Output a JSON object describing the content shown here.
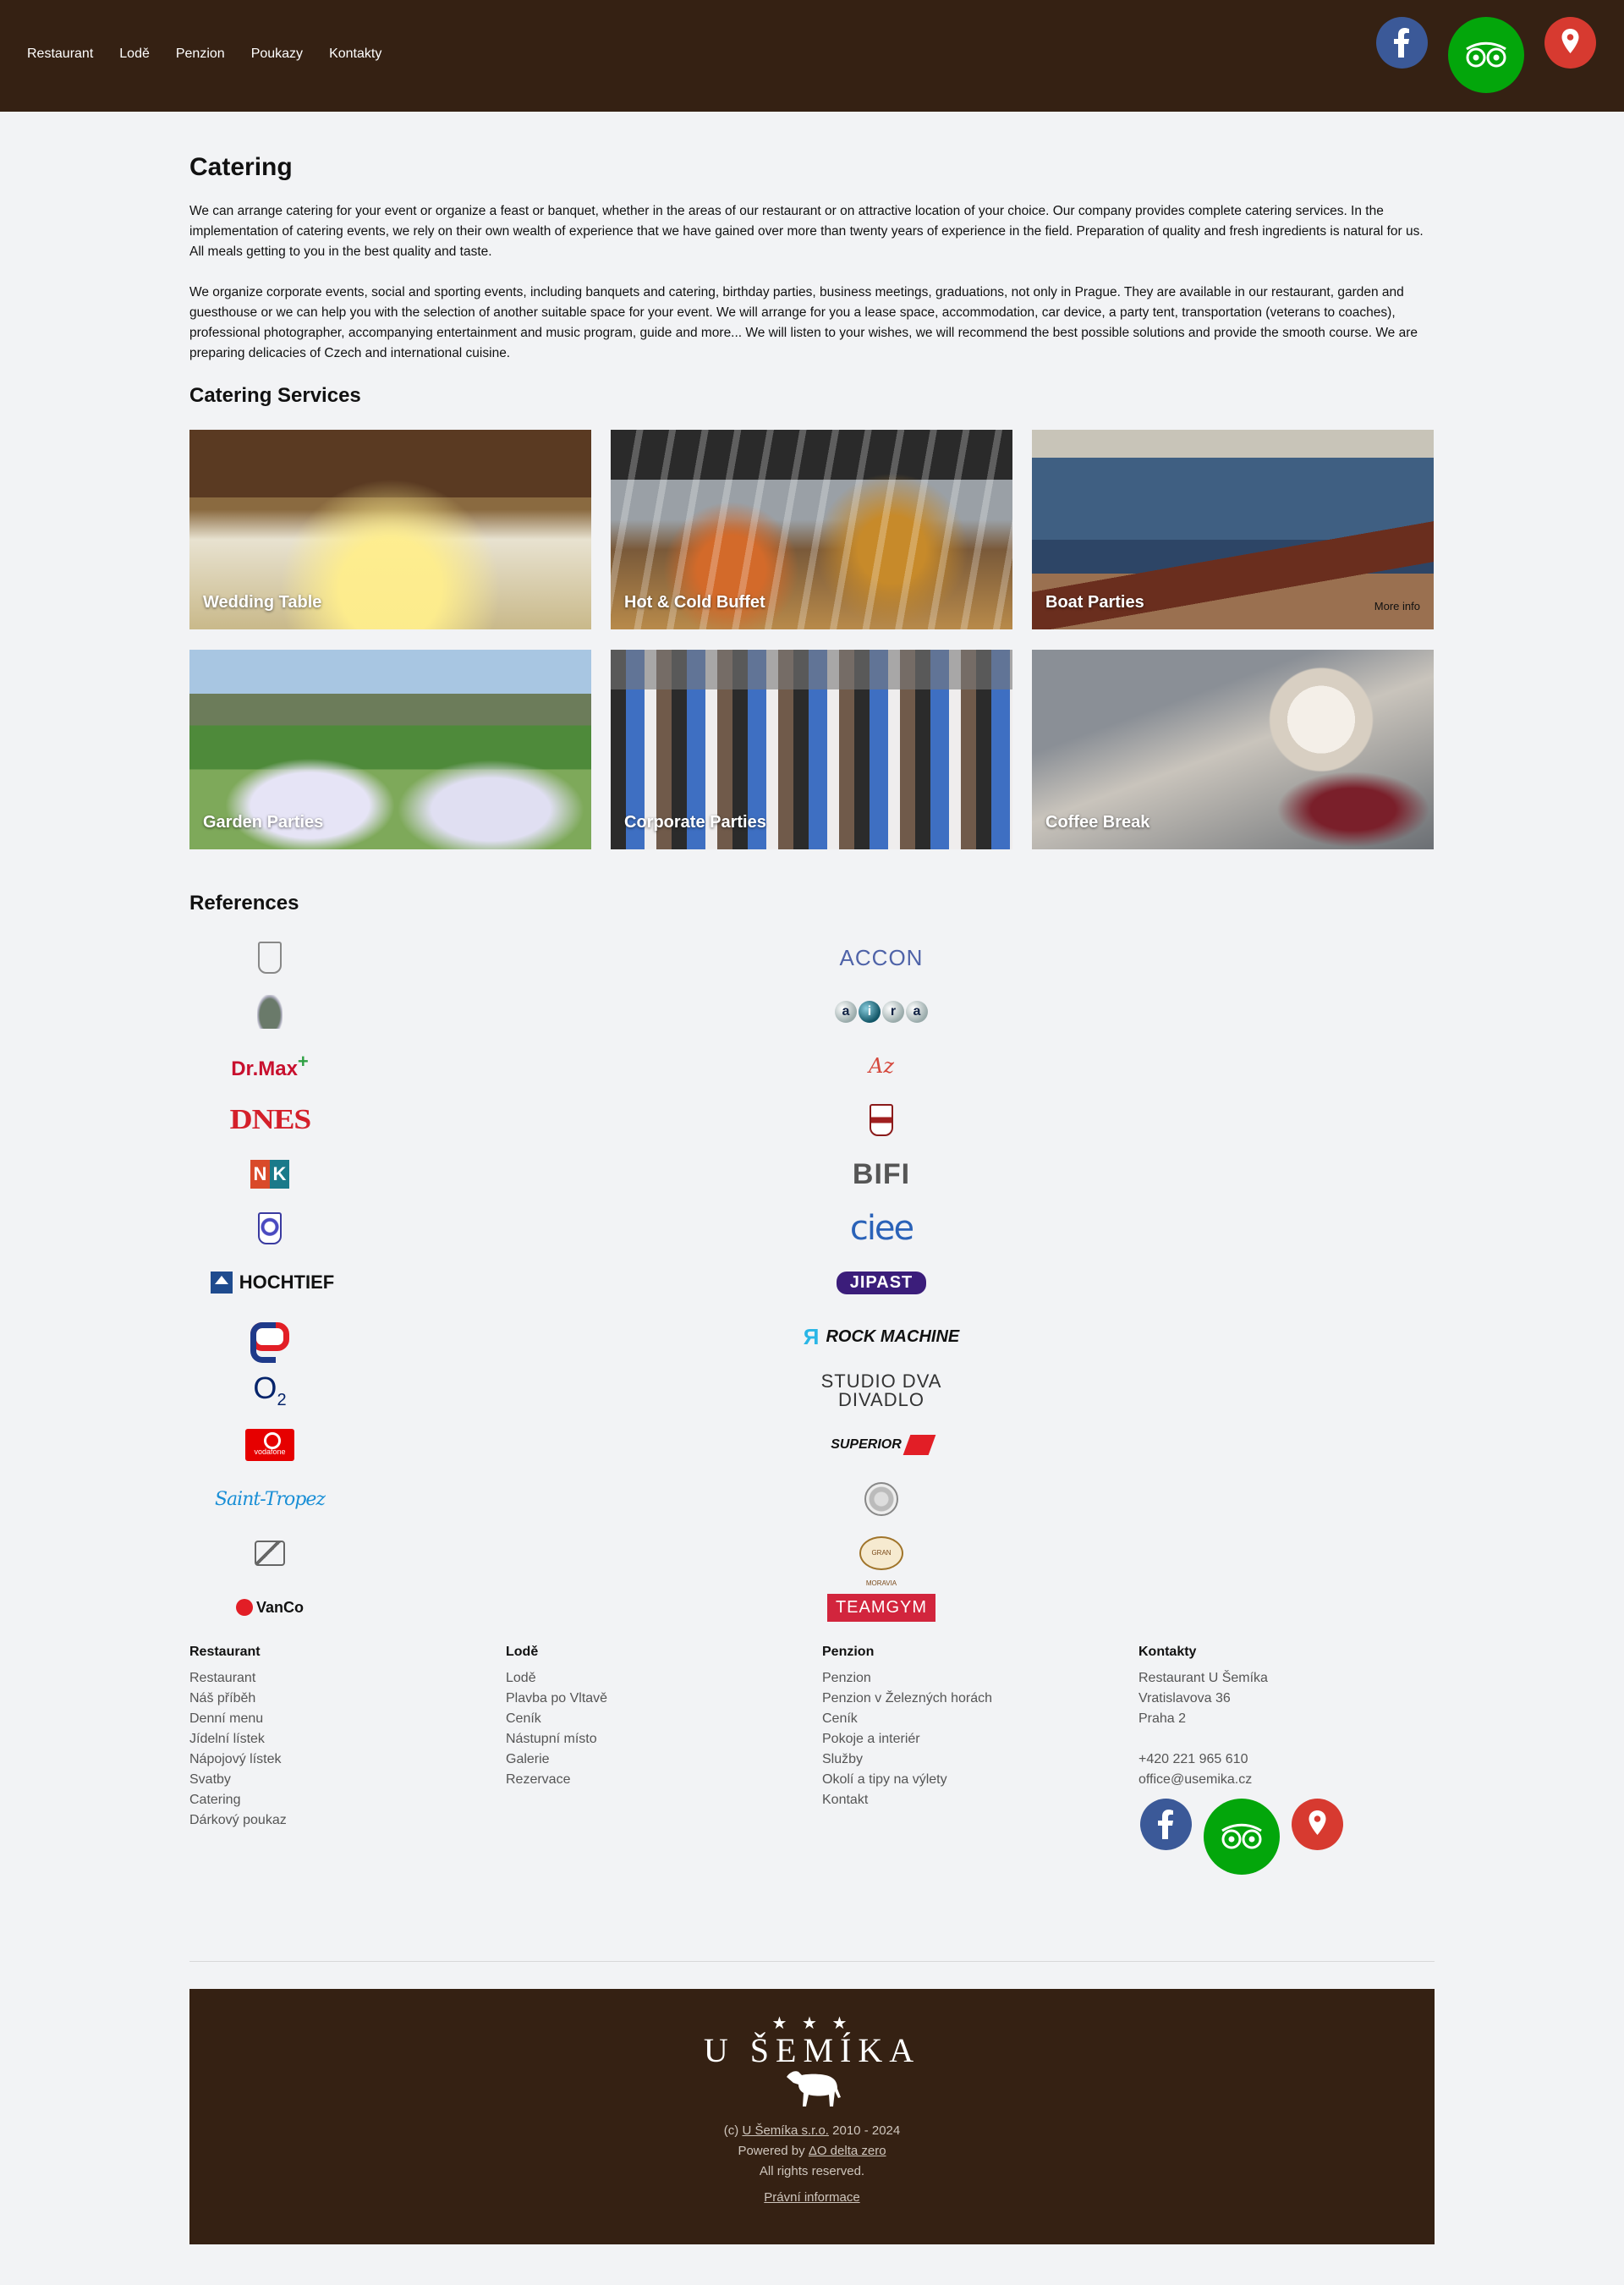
{
  "nav": [
    "Restaurant",
    "Lodě",
    "Penzion",
    "Poukazy",
    "Kontakty"
  ],
  "social": [
    "facebook-icon",
    "tripadvisor-icon",
    "map-pin-icon"
  ],
  "page": {
    "title": "Catering",
    "paragraphs": [
      "We can arrange catering for your event or organize a feast or banquet, whether in the areas of our restaurant or on attractive location of your choice. Our company provides complete catering services. In the implementation of catering events, we rely on their own wealth of experience that we have gained over more than twenty years of experience in the field. Preparation of quality and fresh ingredients is natural for us. All meals getting to you in the best quality and taste.",
      "We organize corporate events, social and sporting events, including banquets and catering, birthday parties, business meetings, graduations, not only in Prague. They are available in our restaurant, garden and guesthouse or we can help you with the selection of another suitable space for your event. We will arrange for you a lease space, accommodation, car device, a party tent, transportation (veterans to coaches), professional photographer, accompanying entertainment and music program, guide and more... We will listen to your wishes, we will recommend the best possible solutions and provide the smooth course. We are preparing delicacies of Czech and international cuisine."
    ]
  },
  "services": {
    "title": "Catering Services",
    "more_label": "More info",
    "items": [
      "Wedding Table",
      "Hot & Cold Buffet",
      "Boat Parties",
      "Garden Parties",
      "Corporate Parties",
      "Coffee Break"
    ]
  },
  "references": {
    "title": "References",
    "left": [
      "",
      "",
      "Dr.Max",
      "DNES",
      "NK",
      "",
      "HOCHTIEF",
      "",
      "O2",
      "vodafone",
      "Saint-Tropez",
      "",
      "VanCo"
    ],
    "right": [
      "ACCON",
      "airpa",
      "Az",
      "",
      "BIFI",
      "ciee",
      "JIPAST",
      "ROCK MACHINE",
      "STUDIO DVA DIVADLO",
      "SUPERIOR",
      "",
      "GRAN MORAVIA",
      "TEAMGYM"
    ]
  },
  "footer": {
    "columns": [
      {
        "title": "Restaurant",
        "links": [
          "Restaurant",
          "Náš příběh",
          "Denní menu",
          "Jídelní lístek",
          "Nápojový lístek",
          "Svatby",
          "Catering",
          "Dárkový poukaz"
        ]
      },
      {
        "title": "Lodě",
        "links": [
          "Lodě",
          "Plavba po Vltavě",
          "Ceník",
          "Nástupní místo",
          "Galerie",
          "Rezervace"
        ]
      },
      {
        "title": "Penzion",
        "links": [
          "Penzion",
          "Penzion v Železných horách",
          "Ceník",
          "Pokoje a interiér",
          "Služby",
          "Okolí a tipy na výlety",
          "Kontakt"
        ]
      },
      {
        "title": "Kontakty",
        "address": [
          "Restaurant U Šemíka",
          "Vratislavova 36",
          "Praha 2"
        ],
        "phone": "+420 221 965 610",
        "email": "office@usemika.cz"
      }
    ]
  },
  "bottom": {
    "stars": "★ ★ ★",
    "brand": "U ŠEMÍKA",
    "copy_prefix": "(c)",
    "company": "U Šemíka s.r.o.",
    "years": "2010 - 2024",
    "powered_prefix": "Powered by",
    "powered_by": "ΔO delta zero",
    "rights": "All rights reserved.",
    "legal": "Právní informace"
  },
  "colors": {
    "header_bg": "#352113",
    "page_bg": "#f2f3f5",
    "facebook": "#3b5998",
    "tripadvisor": "#03a60b",
    "maps": "#d73a30"
  }
}
